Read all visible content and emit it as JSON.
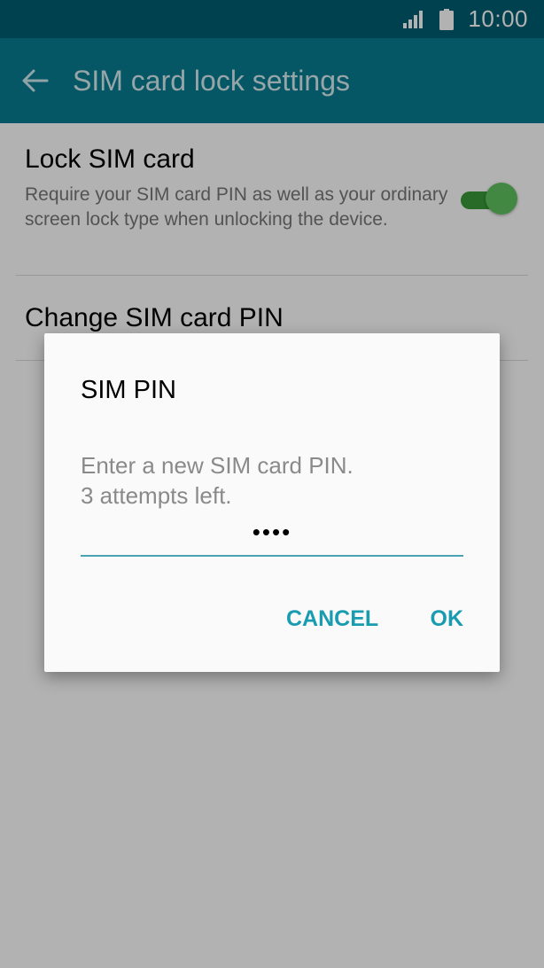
{
  "status_bar": {
    "time": "10:00",
    "icons": [
      "signal-icon",
      "battery-icon"
    ]
  },
  "action_bar": {
    "title": "SIM card lock settings",
    "back_icon": "arrow-back-icon"
  },
  "settings": {
    "lock_sim": {
      "title": "Lock SIM card",
      "summary": "Require your SIM card PIN as well as your ordinary screen lock type when unlocking the device.",
      "toggle_on": true
    },
    "change_pin": {
      "title": "Change SIM card PIN"
    }
  },
  "dialog": {
    "title": "SIM PIN",
    "message_line1": "Enter a new SIM card PIN.",
    "message_line2": "3 attempts left.",
    "pin_value": "1234",
    "cancel_label": "CANCEL",
    "ok_label": "OK"
  },
  "colors": {
    "status_bar": "#005e72",
    "action_bar": "#0a7d92",
    "accent": "#1a9cb0",
    "toggle_on": "#5fc35f"
  }
}
